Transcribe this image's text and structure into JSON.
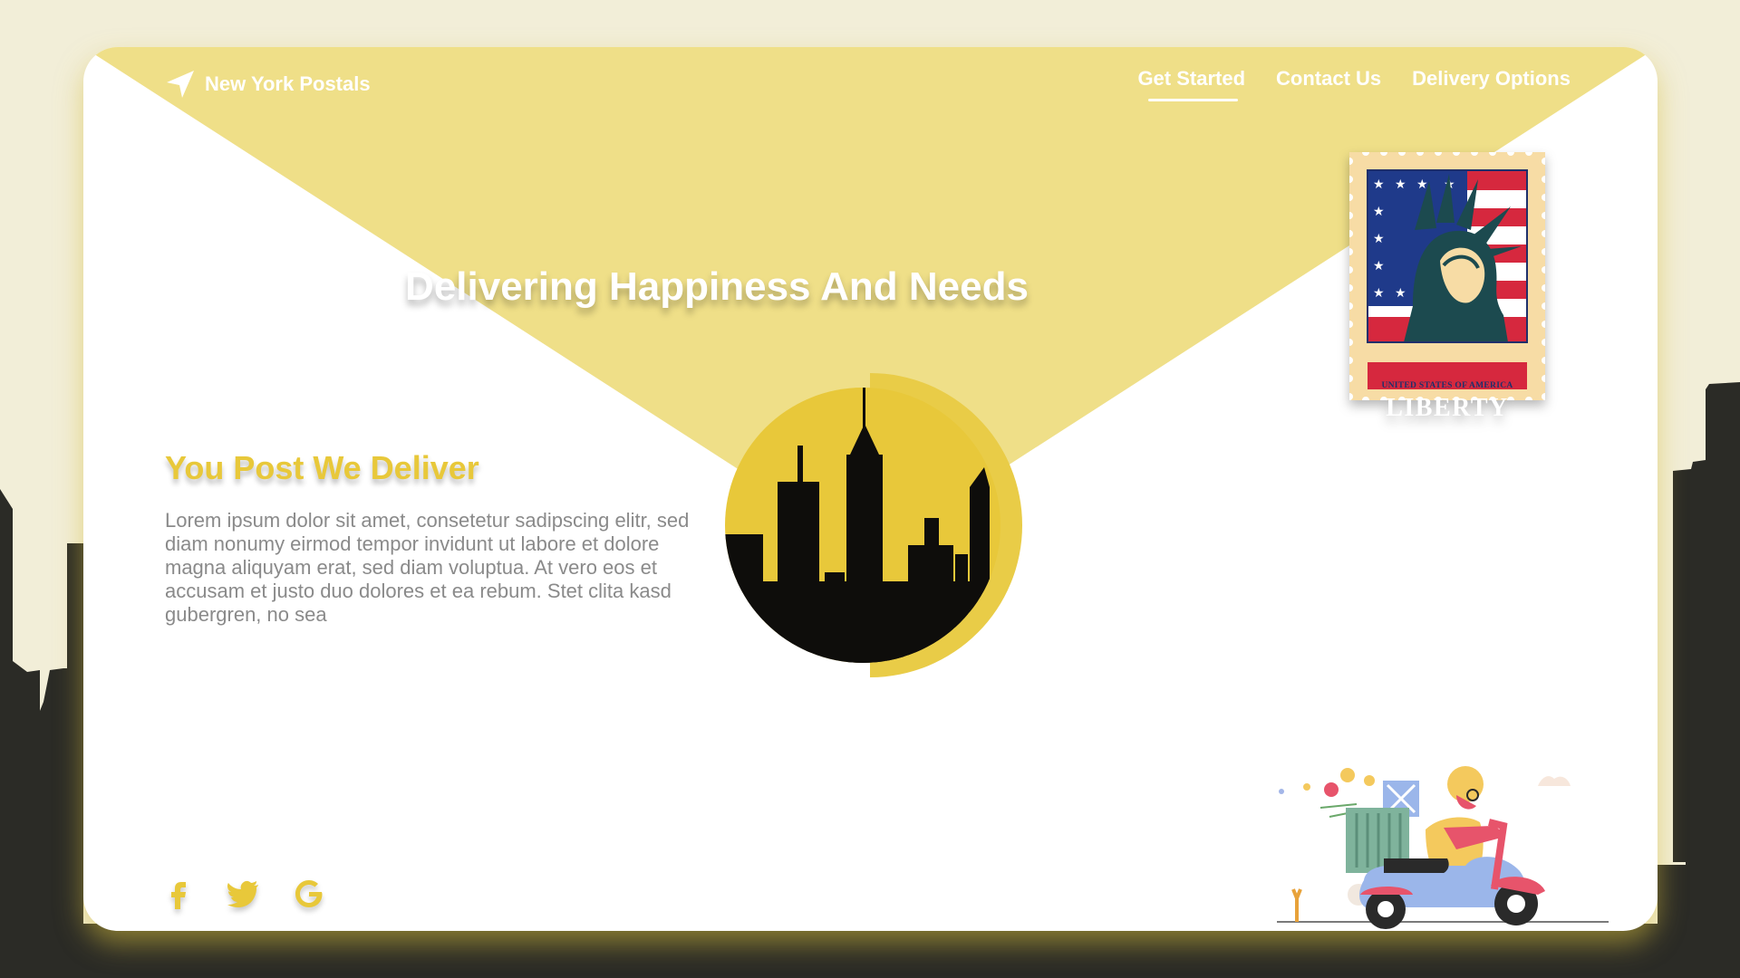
{
  "brand": {
    "name": "New York Postals",
    "icon": "paper-plane-icon"
  },
  "nav": {
    "items": [
      {
        "label": "Get Started",
        "active": true
      },
      {
        "label": "Contact Us",
        "active": false
      },
      {
        "label": "Delivery Options",
        "active": false
      }
    ]
  },
  "hero": {
    "title": "Delivering Happiness And Needs"
  },
  "stamp": {
    "top_text": "UNITED STATES OF AMERICA",
    "main_text": "LIBERTY"
  },
  "section": {
    "title": "You Post We Deliver",
    "body": "Lorem ipsum dolor sit amet, consetetur sadipscing elitr, sed diam nonumy eirmod tempor invidunt ut labore et dolore magna aliquyam erat, sed diam voluptua. At vero eos et accusam et justo duo dolores et ea rebum. Stet clita kasd gubergren, no sea"
  },
  "socials": [
    {
      "name": "facebook-icon"
    },
    {
      "name": "twitter-icon"
    },
    {
      "name": "google-icon"
    }
  ],
  "colors": {
    "background": "#f2eed8",
    "envelope_flap": "#efdf88",
    "accent": "#e8c83a",
    "skyline": "#2b2b26",
    "body_text": "#8a8a8a"
  }
}
